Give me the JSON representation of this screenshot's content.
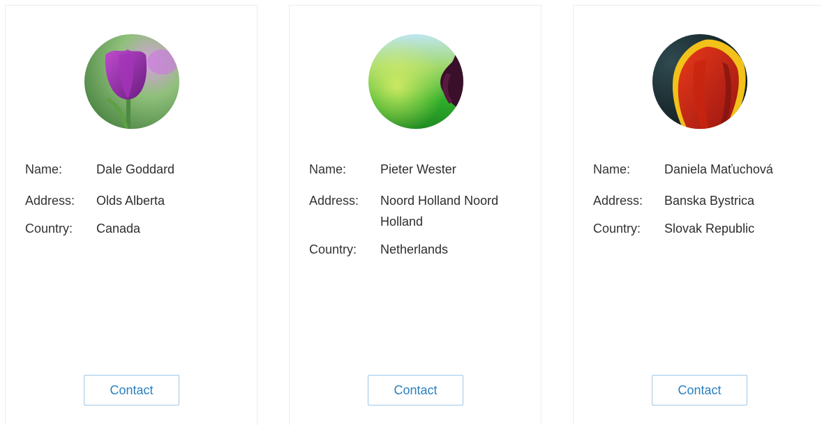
{
  "labels": {
    "name": "Name:",
    "address": "Address:",
    "country": "Country:",
    "contact": "Contact"
  },
  "cards": [
    {
      "name": "Dale Goddard",
      "address": "Olds Alberta",
      "country": "Canada",
      "avatar_icon": "purple-tulip-photo"
    },
    {
      "name": "Pieter Wester",
      "address": "Noord Holland Noord Holland",
      "country": "Netherlands",
      "avatar_icon": "dark-tulip-photo"
    },
    {
      "name": "Daniela Maťuchová",
      "address": "Banska Bystrica",
      "country": "Slovak Republic",
      "avatar_icon": "red-yellow-tulip-photo"
    }
  ],
  "colors": {
    "button_text": "#2a7fc0",
    "button_border": "#9ec6e4",
    "card_border": "#ececec"
  }
}
